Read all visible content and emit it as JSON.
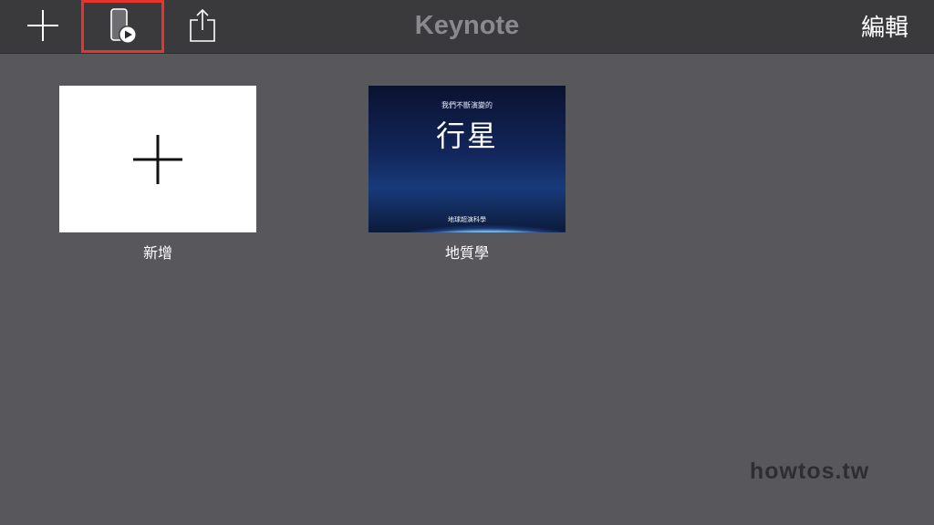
{
  "toolbar": {
    "title": "Keynote",
    "edit_label": "編輯",
    "add_icon": "plus-icon",
    "play_icon": "device-play-icon",
    "share_icon": "share-icon",
    "highlight_color": "#e8342c"
  },
  "documents": [
    {
      "caption": "新增",
      "icon": "plus-icon"
    },
    {
      "caption": "地質學",
      "thumbnail": {
        "subtitle": "我們不斷演變的",
        "title": "行星",
        "footer": "地球超演科學"
      }
    }
  ],
  "watermark": "howtos.tw"
}
